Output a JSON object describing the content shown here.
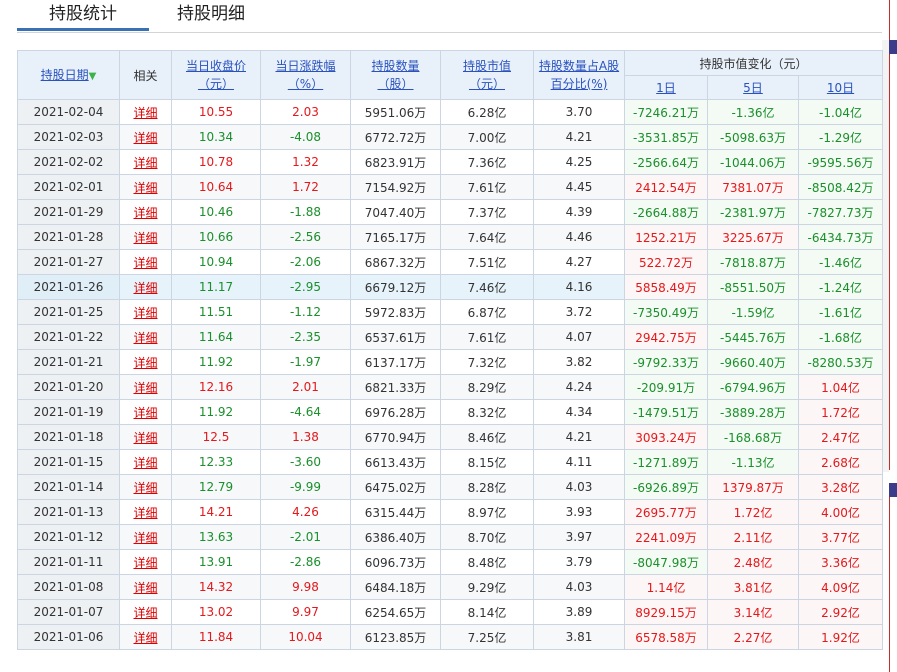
{
  "tabs": [
    "持股统计",
    "持股明细"
  ],
  "header": {
    "date": "持股日期",
    "related": "相关",
    "close_l1": "当日收盘价",
    "close_l2": "（元）",
    "pct_l1": "当日涨跌幅",
    "pct_l2": "（%）",
    "qty_l1": "持股数量",
    "qty_l2": "（股）",
    "mv_l1": "持股市值",
    "mv_l2": "（元）",
    "ratio_l1": "持股数量占A股",
    "ratio_l2": "百分比(%)",
    "change_group": "持股市值变化（元）",
    "d1": "1日",
    "d5": "5日",
    "d10": "10日"
  },
  "link_text": "详细",
  "rows": [
    [
      "2021-02-04",
      "10.55",
      "2.03",
      "5951.06万",
      "6.28亿",
      "3.70",
      "-7246.21万",
      "-1.36亿",
      "-1.04亿"
    ],
    [
      "2021-02-03",
      "10.34",
      "-4.08",
      "6772.72万",
      "7.00亿",
      "4.21",
      "-3531.85万",
      "-5098.63万",
      "-1.29亿"
    ],
    [
      "2021-02-02",
      "10.78",
      "1.32",
      "6823.91万",
      "7.36亿",
      "4.25",
      "-2566.64万",
      "-1044.06万",
      "-9595.56万"
    ],
    [
      "2021-02-01",
      "10.64",
      "1.72",
      "7154.92万",
      "7.61亿",
      "4.45",
      "2412.54万",
      "7381.07万",
      "-8508.42万"
    ],
    [
      "2021-01-29",
      "10.46",
      "-1.88",
      "7047.40万",
      "7.37亿",
      "4.39",
      "-2664.88万",
      "-2381.97万",
      "-7827.73万"
    ],
    [
      "2021-01-28",
      "10.66",
      "-2.56",
      "7165.17万",
      "7.64亿",
      "4.46",
      "1252.21万",
      "3225.67万",
      "-6434.73万"
    ],
    [
      "2021-01-27",
      "10.94",
      "-2.06",
      "6867.32万",
      "7.51亿",
      "4.27",
      "522.72万",
      "-7818.87万",
      "-1.46亿"
    ],
    [
      "2021-01-26",
      "11.17",
      "-2.95",
      "6679.12万",
      "7.46亿",
      "4.16",
      "5858.49万",
      "-8551.50万",
      "-1.24亿"
    ],
    [
      "2021-01-25",
      "11.51",
      "-1.12",
      "5972.83万",
      "6.87亿",
      "3.72",
      "-7350.49万",
      "-1.59亿",
      "-1.61亿"
    ],
    [
      "2021-01-22",
      "11.64",
      "-2.35",
      "6537.61万",
      "7.61亿",
      "4.07",
      "2942.75万",
      "-5445.76万",
      "-1.68亿"
    ],
    [
      "2021-01-21",
      "11.92",
      "-1.97",
      "6137.17万",
      "7.32亿",
      "3.82",
      "-9792.33万",
      "-9660.40万",
      "-8280.53万"
    ],
    [
      "2021-01-20",
      "12.16",
      "2.01",
      "6821.33万",
      "8.29亿",
      "4.24",
      "-209.91万",
      "-6794.96万",
      "1.04亿"
    ],
    [
      "2021-01-19",
      "11.92",
      "-4.64",
      "6976.28万",
      "8.32亿",
      "4.34",
      "-1479.51万",
      "-3889.28万",
      "1.72亿"
    ],
    [
      "2021-01-18",
      "12.5",
      "1.38",
      "6770.94万",
      "8.46亿",
      "4.21",
      "3093.24万",
      "-168.68万",
      "2.47亿"
    ],
    [
      "2021-01-15",
      "12.33",
      "-3.60",
      "6613.43万",
      "8.15亿",
      "4.11",
      "-1271.89万",
      "-1.13亿",
      "2.68亿"
    ],
    [
      "2021-01-14",
      "12.79",
      "-9.99",
      "6475.02万",
      "8.28亿",
      "4.03",
      "-6926.89万",
      "1379.87万",
      "3.28亿"
    ],
    [
      "2021-01-13",
      "14.21",
      "4.26",
      "6315.44万",
      "8.97亿",
      "3.93",
      "2695.77万",
      "1.72亿",
      "4.00亿"
    ],
    [
      "2021-01-12",
      "13.63",
      "-2.01",
      "6386.40万",
      "8.70亿",
      "3.97",
      "2241.09万",
      "2.11亿",
      "3.77亿"
    ],
    [
      "2021-01-11",
      "13.91",
      "-2.86",
      "6096.73万",
      "8.48亿",
      "3.79",
      "-8047.98万",
      "2.48亿",
      "3.36亿"
    ],
    [
      "2021-01-08",
      "14.32",
      "9.98",
      "6484.18万",
      "9.29亿",
      "4.03",
      "1.14亿",
      "3.81亿",
      "4.09亿"
    ],
    [
      "2021-01-07",
      "13.02",
      "9.97",
      "6254.65万",
      "8.14亿",
      "3.89",
      "8929.15万",
      "3.14亿",
      "2.92亿"
    ],
    [
      "2021-01-06",
      "11.84",
      "10.04",
      "6123.85万",
      "7.25亿",
      "3.81",
      "6578.58万",
      "2.27亿",
      "1.92亿"
    ]
  ],
  "highlight_date": "2021-01-26",
  "colors": {
    "up": "#e4181b",
    "down": "#1a8f2b",
    "link": "#2a52be",
    "header_bg": "#e8f1fa",
    "tab_accent": "#3a71b4"
  },
  "icons": {
    "sort": "arrow-down-icon"
  }
}
